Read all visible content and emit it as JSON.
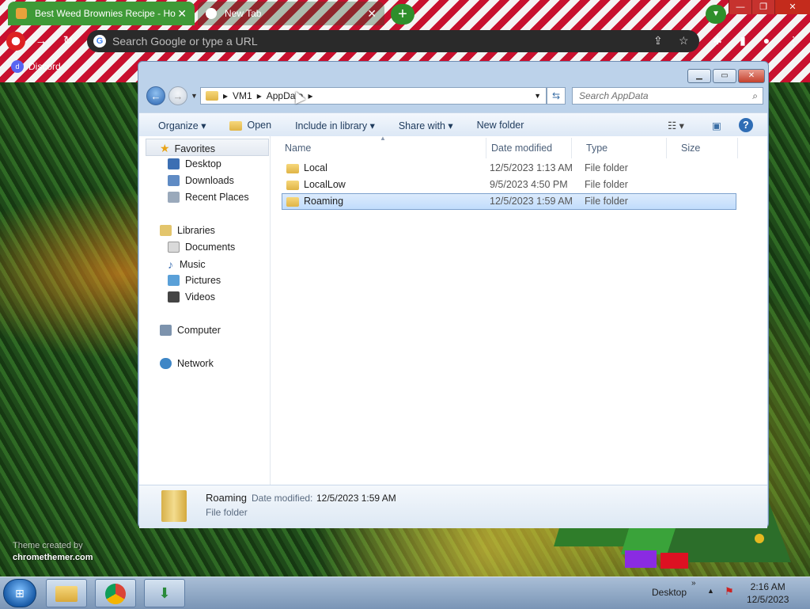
{
  "browser": {
    "tabs": [
      {
        "label": "Best Weed Brownies Recipe - Ho",
        "active": true
      },
      {
        "label": "New Tab",
        "active": false
      }
    ],
    "omnibox_placeholder": "Search Google or type a URL",
    "bookmarks": [
      {
        "label": "Discord"
      }
    ],
    "window_controls": {
      "minimize": "—",
      "maximize": "❐",
      "close": "✕"
    }
  },
  "explorer": {
    "breadcrumb": [
      "VM1",
      "AppData"
    ],
    "search_placeholder": "Search AppData",
    "toolbar": {
      "organize": "Organize",
      "open": "Open",
      "include_in_library": "Include in library",
      "share_with": "Share with",
      "new_folder": "New folder"
    },
    "nav": {
      "favorites": "Favorites",
      "favorites_items": [
        "Desktop",
        "Downloads",
        "Recent Places"
      ],
      "libraries": "Libraries",
      "libraries_items": [
        "Documents",
        "Music",
        "Pictures",
        "Videos"
      ],
      "computer": "Computer",
      "network": "Network"
    },
    "columns": {
      "name": "Name",
      "date_modified": "Date modified",
      "type": "Type",
      "size": "Size"
    },
    "files": [
      {
        "name": "Local",
        "date": "12/5/2023 1:13 AM",
        "type": "File folder",
        "selected": false
      },
      {
        "name": "LocalLow",
        "date": "9/5/2023 4:50 PM",
        "type": "File folder",
        "selected": false
      },
      {
        "name": "Roaming",
        "date": "12/5/2023 1:59 AM",
        "type": "File folder",
        "selected": true
      }
    ],
    "details": {
      "name": "Roaming",
      "date_label": "Date modified:",
      "date_value": "12/5/2023 1:59 AM",
      "type": "File folder"
    }
  },
  "desktop": {
    "watermark_line1": "Theme created by",
    "watermark_line2": "chromethemer.com"
  },
  "taskbar": {
    "desktop_label": "Desktop",
    "time": "2:16 AM",
    "date": "12/5/2023"
  },
  "colors": {
    "accent_tab": "#3f9a37",
    "selection": "#c1dcfc",
    "stripe_red": "#c8102e"
  }
}
